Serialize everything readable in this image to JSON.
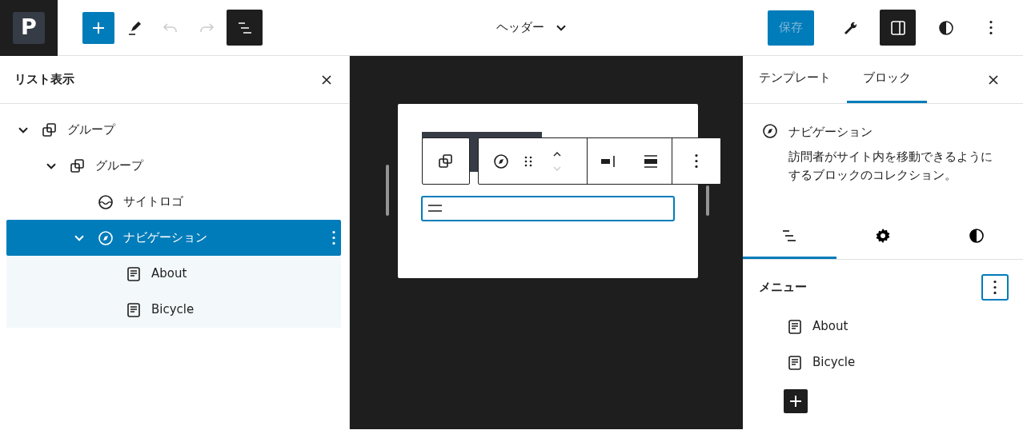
{
  "logo": {
    "text": "P"
  },
  "toolbar": [
    {
      "kind": "add",
      "pressed": false,
      "disabled": false
    },
    {
      "kind": "edit",
      "pressed": false,
      "disabled": false
    },
    {
      "kind": "undo",
      "pressed": false,
      "disabled": true
    },
    {
      "kind": "redo",
      "pressed": false,
      "disabled": true
    },
    {
      "kind": "list",
      "pressed": true,
      "disabled": false
    }
  ],
  "document_title": "ヘッダー",
  "save_button": {
    "label": "保存",
    "disabled": true
  },
  "actions": [
    {
      "kind": "tools",
      "pressed": false
    },
    {
      "kind": "sidebar",
      "pressed": true
    },
    {
      "kind": "styles",
      "pressed": false
    },
    {
      "kind": "more",
      "pressed": false
    }
  ],
  "list_view": {
    "title": "リスト表示",
    "items": [
      {
        "label": "グループ",
        "kind": "group",
        "expanded": true,
        "selected": false,
        "children": [
          {
            "label": "グループ",
            "kind": "group",
            "expanded": true,
            "selected": false,
            "children": [
              {
                "label": "サイトロゴ",
                "kind": "logo",
                "selected": false
              },
              {
                "label": "ナビゲーション",
                "kind": "navigation",
                "expanded": true,
                "selected": true,
                "children": [
                  {
                    "label": "About",
                    "kind": "page",
                    "selected": false
                  },
                  {
                    "label": "Bicycle",
                    "kind": "page",
                    "selected": false
                  }
                ]
              }
            ]
          }
        ]
      }
    ]
  },
  "canvas": {
    "kind": "navigation"
  },
  "sidebar": {
    "tabs": [
      {
        "label": "テンプレート",
        "selected": false
      },
      {
        "label": "ブロック",
        "selected": true
      }
    ],
    "block": {
      "title": "ナビゲーション",
      "description": "訪問者がサイト内を移動できるようにするブロックのコレクション。"
    },
    "panel_tabs": [
      {
        "kind": "list",
        "selected": true
      },
      {
        "kind": "settings",
        "selected": false
      },
      {
        "kind": "styles",
        "selected": false
      }
    ],
    "menu": {
      "title": "メニュー",
      "items": [
        {
          "label": "About"
        },
        {
          "label": "Bicycle"
        }
      ]
    }
  }
}
